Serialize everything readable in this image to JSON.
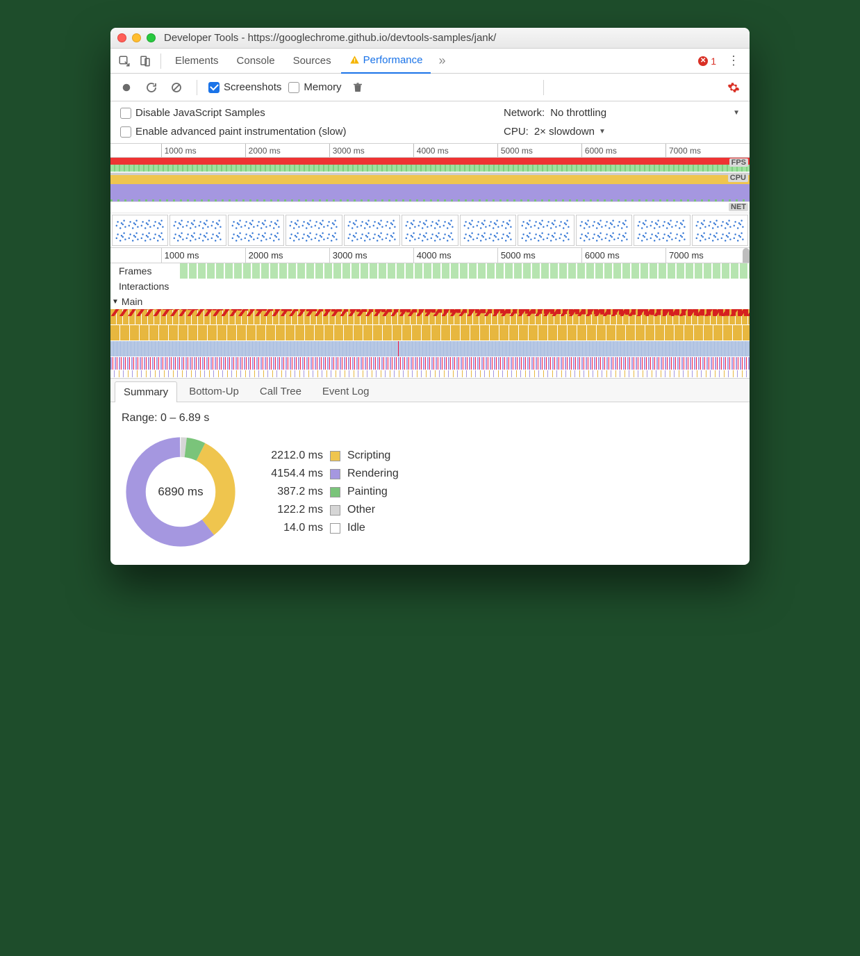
{
  "window": {
    "title": "Developer Tools - https://googlechrome.github.io/devtools-samples/jank/"
  },
  "tabs": {
    "elements": "Elements",
    "console": "Console",
    "sources": "Sources",
    "performance": "Performance",
    "error_count": "1"
  },
  "toolbar": {
    "screenshots": "Screenshots",
    "memory": "Memory"
  },
  "settings": {
    "disable_js": "Disable JavaScript Samples",
    "advanced_paint": "Enable advanced paint instrumentation (slow)",
    "network_label": "Network:",
    "network_value": "No throttling",
    "cpu_label": "CPU:",
    "cpu_value": "2× slowdown"
  },
  "overview": {
    "ticks": [
      "1000 ms",
      "2000 ms",
      "3000 ms",
      "4000 ms",
      "5000 ms",
      "6000 ms",
      "7000 ms"
    ],
    "fps_label": "FPS",
    "cpu_label": "CPU",
    "net_label": "NET"
  },
  "detail": {
    "ticks": [
      "1000 ms",
      "2000 ms",
      "3000 ms",
      "4000 ms",
      "5000 ms",
      "6000 ms",
      "7000 ms"
    ],
    "frames": "Frames",
    "interactions": "Interactions",
    "main": "Main"
  },
  "bottom_tabs": {
    "summary": "Summary",
    "bottomup": "Bottom-Up",
    "calltree": "Call Tree",
    "eventlog": "Event Log"
  },
  "summary": {
    "range": "Range: 0 – 6.89 s",
    "total": "6890 ms",
    "legend": [
      {
        "value": "2212.0 ms",
        "label": "Scripting",
        "class": "c-script"
      },
      {
        "value": "4154.4 ms",
        "label": "Rendering",
        "class": "c-render"
      },
      {
        "value": "387.2 ms",
        "label": "Painting",
        "class": "c-paint"
      },
      {
        "value": "122.2 ms",
        "label": "Other",
        "class": "c-other"
      },
      {
        "value": "14.0 ms",
        "label": "Idle",
        "class": "c-idle"
      }
    ]
  },
  "chart_data": {
    "type": "pie",
    "title": "Time breakdown",
    "total_ms": 6890,
    "series": [
      {
        "name": "Scripting",
        "value": 2212.0,
        "color": "#efc54e"
      },
      {
        "name": "Rendering",
        "value": 4154.4,
        "color": "#a597e0"
      },
      {
        "name": "Painting",
        "value": 387.2,
        "color": "#7ac47a"
      },
      {
        "name": "Other",
        "value": 122.2,
        "color": "#d6d6d6"
      },
      {
        "name": "Idle",
        "value": 14.0,
        "color": "#ffffff"
      }
    ]
  }
}
